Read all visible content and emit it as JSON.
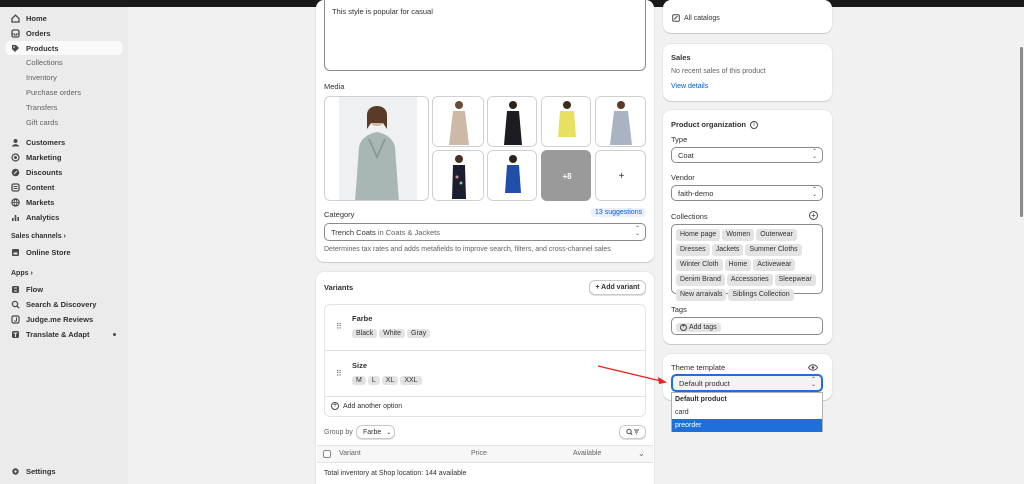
{
  "sidebar": {
    "items": [
      {
        "label": "Home",
        "icon": "home-icon"
      },
      {
        "label": "Orders",
        "icon": "orders-icon"
      },
      {
        "label": "Products",
        "icon": "tag-icon",
        "active": true
      }
    ],
    "product_subitems": [
      "Collections",
      "Inventory",
      "Purchase orders",
      "Transfers",
      "Gift cards"
    ],
    "items2": [
      {
        "label": "Customers",
        "icon": "person-icon"
      },
      {
        "label": "Marketing",
        "icon": "target-icon"
      },
      {
        "label": "Discounts",
        "icon": "discount-icon"
      },
      {
        "label": "Content",
        "icon": "content-icon"
      },
      {
        "label": "Markets",
        "icon": "globe-icon"
      },
      {
        "label": "Analytics",
        "icon": "bar-chart-icon"
      }
    ],
    "sales_channels_heading": "Sales channels",
    "online_store": "Online Store",
    "apps_heading": "Apps",
    "apps": [
      "Flow",
      "Search & Discovery",
      "Judge.me Reviews",
      "Translate & Adapt"
    ],
    "settings": "Settings"
  },
  "description": {
    "text": "This style is popular for casual"
  },
  "media": {
    "title": "Media",
    "more_count": "+8",
    "add_symbol": "+"
  },
  "category": {
    "label": "Category",
    "suggestions": "13 suggestions",
    "value_main": "Trench Coats",
    "value_rest": " in Coats & Jackets",
    "help": "Determines tax rates and adds metafields to improve search, filters, and cross-channel sales"
  },
  "variants": {
    "title": "Variants",
    "add_variant": "+ Add variant",
    "options": [
      {
        "name": "Farbe",
        "values": [
          "Black",
          "White",
          "Gray"
        ]
      },
      {
        "name": "Size",
        "values": [
          "M",
          "L",
          "XL",
          "XXL"
        ]
      }
    ],
    "add_option": "Add another option",
    "group_by_label": "Group by",
    "group_by_value": "Farbe",
    "columns": {
      "variant": "Variant",
      "price": "Price",
      "available": "Available"
    },
    "total_inventory": "Total inventory at Shop location: 144 available"
  },
  "catalogs": {
    "link": "All catalogs"
  },
  "sales": {
    "title": "Sales",
    "text": "No recent sales of this product",
    "link": "View details"
  },
  "organization": {
    "title": "Product organization",
    "type_label": "Type",
    "type_value": "Coat",
    "vendor_label": "Vendor",
    "vendor_value": "faith-demo",
    "collections_label": "Collections",
    "collections": [
      "Home page",
      "Women",
      "Outerwear",
      "Dresses",
      "Jackets",
      "Summer Cloths",
      "Winter Cloth",
      "Home",
      "Activewear",
      "Denim Brand",
      "Accessories",
      "Sleepwear",
      "New arraivals",
      "Siblings Collection"
    ],
    "tags_label": "Tags",
    "add_tags": "Add tags"
  },
  "theme": {
    "label": "Theme template",
    "selected": "Default product",
    "options": [
      "Default product",
      "card",
      "preorder"
    ],
    "highlighted": "preorder"
  },
  "colors": {
    "accent": "#005bd3",
    "highlight": "#1e6fd9",
    "arrow": "#e8231f"
  }
}
